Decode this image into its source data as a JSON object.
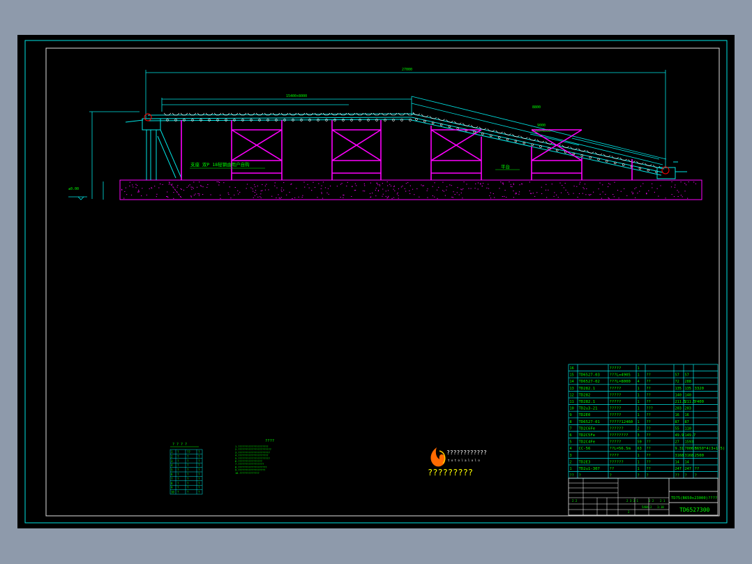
{
  "drawing": {
    "title_block": {
      "drawing_number": "TD6527300",
      "drawing_name": "TD75(B650x23000)????",
      "scale_marks": [
        "2 3 3 1",
        "2 2",
        "2 1",
        "2 2",
        "5484.2",
        "1:10",
        "2"
      ]
    },
    "annotations": {
      "note_support": "支座 双P 18轻钢由用户自购",
      "note_platform": "平台",
      "ground_level": "±0.00",
      "dim_total": "27000",
      "dim_horizontal": "15400+8000",
      "dim_inclined": "8800",
      "dim_inclined_sub": "9000",
      "dim_inclined_sub2": "5000+4000"
    },
    "parts_list": {
      "rows": [
        [
          "16",
          "",
          "?????",
          "1",
          "",
          "",
          "",
          ""
        ],
        [
          "15",
          "TD6527-03",
          "???L=4905",
          "1",
          "??",
          "57",
          "57",
          ""
        ],
        [
          "14",
          "TD6527-02",
          "???L=8000",
          "4",
          "??",
          "72",
          "288",
          ""
        ],
        [
          "13",
          "TD282.1",
          "?????",
          "1",
          "??",
          "135",
          "135",
          "3320"
        ],
        [
          "12",
          "TD282",
          "?????",
          "1",
          "??",
          "140",
          "140",
          ""
        ],
        [
          "11",
          "TD282.1",
          "?????",
          "1",
          "??",
          "211.5",
          "211.5",
          "?400"
        ],
        [
          "10",
          "TD2u3-21",
          "?????",
          "1",
          "???",
          "203",
          "203",
          ""
        ],
        [
          "9",
          "TD2E0",
          "?????",
          "1",
          "??",
          "16",
          "16",
          ""
        ],
        [
          "8",
          "TD6527-01",
          "?????12460",
          "1",
          "??",
          "87",
          "87",
          ""
        ],
        [
          "7",
          "TD2C6Fe",
          "??????",
          "2",
          "??",
          "55",
          "110",
          ""
        ],
        [
          "6",
          "TD2C5Fe",
          "????????",
          "3",
          "??",
          "49.9",
          "149.7",
          ""
        ],
        [
          "5",
          "TD2C4Fe",
          "?????",
          "59",
          "??",
          "27",
          "1593",
          ""
        ],
        [
          "4",
          "CC-56",
          "??L=56.5m",
          "63",
          "??",
          "9.31",
          "7006",
          "B650*4(3+1.5)"
        ],
        [
          "3",
          "",
          "????",
          "1",
          "??",
          "3168",
          "3168",
          "2500"
        ],
        [
          "2",
          "TD2E3",
          "??????",
          "1",
          "??",
          "14",
          "14",
          ""
        ],
        [
          "1",
          "TD2u1-307",
          "??",
          "1",
          "??",
          "247",
          "247",
          "??"
        ],
        [
          "??",
          "?",
          "?",
          "?",
          "?",
          "??",
          "?",
          "?"
        ]
      ]
    },
    "left_table": {
      "title": "? ? ? ?",
      "rows": [
        [
          "1",
          "?",
          "??",
          "?"
        ],
        [
          "2",
          "?",
          "?",
          "?"
        ],
        [
          "3",
          "?",
          "?",
          "?"
        ],
        [
          "4",
          "?",
          "?",
          "?"
        ],
        [
          "5",
          "?",
          "?",
          "?"
        ],
        [
          "6",
          "?",
          "?",
          "?"
        ],
        [
          "7",
          "?",
          "?",
          "?"
        ],
        [
          "8",
          "?",
          "?",
          "?"
        ],
        [
          "9",
          "?",
          "?",
          "?"
        ],
        [
          "10",
          "?",
          "?",
          "?"
        ]
      ]
    },
    "notes_block": {
      "title": "????",
      "lines": [
        "1.????????????????????",
        "2.??????????????????????",
        "3.?????????????????????",
        "4.????????????????????",
        "5.?????????????????????",
        "6.????????????????",
        "7.?????????????????",
        "8.???????????????????",
        "9.??????????????????",
        "10.?????????????"
      ]
    },
    "logo": {
      "top_text": "????????????",
      "sub_text": "t o t o l a l o l o",
      "caption": "?????????"
    },
    "colors": {
      "background": "#000000",
      "frame": "#00ffff",
      "structure_magenta": "#ff00ff",
      "dimension": "#00ffff",
      "text_green": "#00ff00",
      "text_yellow": "#ffff00",
      "table_lines": "#00ffff",
      "ground": "#ff00ff"
    }
  }
}
